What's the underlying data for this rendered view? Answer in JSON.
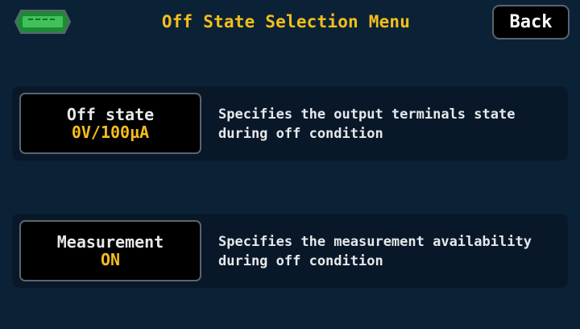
{
  "header": {
    "title": "Off State Selection Menu",
    "back_label": "Back",
    "battery_icon": "battery-icon"
  },
  "settings": [
    {
      "label": "Off state",
      "value": "0V/100µA",
      "description": "Specifies the output terminals state during off condition"
    },
    {
      "label": "Measurement",
      "value": "ON",
      "description": "Specifies the measurement availability during off condition"
    }
  ],
  "colors": {
    "background": "#0b2236",
    "accent": "#f5be1b",
    "battery": "#2db34a"
  }
}
